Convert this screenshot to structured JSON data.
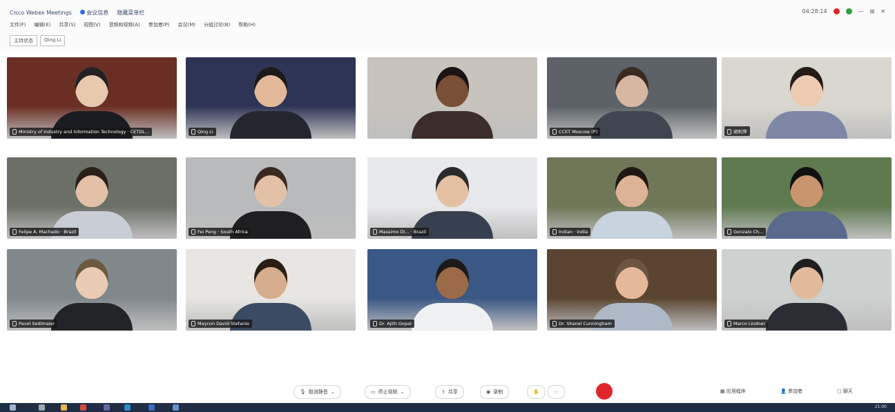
{
  "window": {
    "title": "Cisco Webex Meetings",
    "status": "会议信息",
    "record": "隐藏菜单栏",
    "timer": "04:28:14"
  },
  "menu": [
    "文件(F)",
    "编辑(E)",
    "共享(S)",
    "视图(V)",
    "音频和视频(A)",
    "参加者(P)",
    "会议(M)",
    "分组讨论(B)",
    "帮助(H)"
  ],
  "view_chips": [
    "主持状态",
    "Qing Li"
  ],
  "participants": [
    {
      "name": "Ministry of Industry and Information Technology · CETDL...",
      "bg": "#6b2e24",
      "skin": "#e9c9ae",
      "shirt": "#1b1b22",
      "hair": "#222"
    },
    {
      "name": "Qing Li",
      "bg": "#2e3456",
      "skin": "#e4b999",
      "shirt": "#24262f",
      "hair": "#1a1a1a"
    },
    {
      "name": "",
      "bg": "#c8c4bd",
      "skin": "#7a4f37",
      "shirt": "#3b2d2a",
      "hair": "#1c1414"
    },
    {
      "name": "CCET Moscow (P)",
      "bg": "#5c6267",
      "skin": "#d8b7a0",
      "shirt": "#404650",
      "hair": "#3a2b22"
    },
    {
      "name": "胡利萍",
      "bg": "#d9d7cf",
      "skin": "#edcab2",
      "shirt": "#7e87a6",
      "hair": "#241a16"
    },
    {
      "name": "Felipe A. Machado · Brazil",
      "bg": "#6b6f66",
      "skin": "#e2bfa7",
      "shirt": "#c9ced6",
      "hair": "#2a2018"
    },
    {
      "name": "Fei Peng · South Africa",
      "bg": "#b8babb",
      "skin": "#e3c1a9",
      "shirt": "#1f1f22",
      "hair": "#3b2a20"
    },
    {
      "name": "Massimo Di... · Brazil",
      "bg": "#e8e9ec",
      "skin": "#e4c0a3",
      "shirt": "#37404e",
      "hair": "#2b2b2b"
    },
    {
      "name": "Indian · India",
      "bg": "#6f7758",
      "skin": "#dcb396",
      "shirt": "#c8d3e0",
      "hair": "#1f1812"
    },
    {
      "name": "Gonzalo Ch...",
      "bg": "#5e7a4f",
      "skin": "#c9956f",
      "shirt": "#5a6a8c",
      "hair": "#111"
    },
    {
      "name": "Pavel Sedlmaier",
      "bg": "#80888c",
      "skin": "#e9cbb5",
      "shirt": "#232428",
      "hair": "#6b5a40"
    },
    {
      "name": "Maycon David Stefanio",
      "bg": "#e7e6e2",
      "skin": "#d6ad8e",
      "shirt": "#3a4b63",
      "hair": "#2a1d14"
    },
    {
      "name": "Dr. Ajith Gopal",
      "bg": "#3a5785",
      "skin": "#9b6a48",
      "shirt": "#eef0f2",
      "hair": "#1a1a1a"
    },
    {
      "name": "Dr. Shanel Cunningham",
      "bg": "#5b4532",
      "skin": "#e6b89a",
      "shirt": "#aeb9c7",
      "hair": "#6a5642"
    },
    {
      "name": "Marco Lindner",
      "bg": "#cdd1cf",
      "skin": "#e0ba9b",
      "shirt": "#2a2d34",
      "hair": "#1e1e1e"
    }
  ],
  "toolbar": {
    "mute": "取消静音",
    "video": "停止视频",
    "share": "共享",
    "record": "录制",
    "apps": "应用程序",
    "participants": "参加者",
    "chat": "聊天"
  },
  "taskbar": {
    "time": "21:00"
  }
}
